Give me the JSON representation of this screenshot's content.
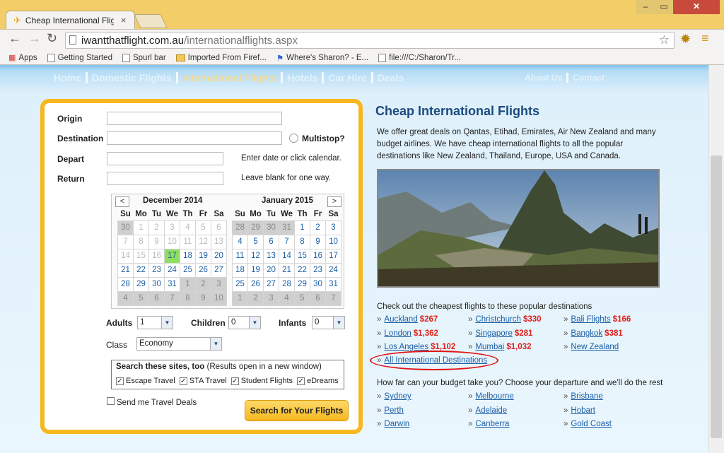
{
  "browser": {
    "tab_title": "Cheap International Flight",
    "tab_close": "×",
    "url_host": "iwantthatflight.com.au",
    "url_path": "/internationalflights.aspx",
    "bookmarks": [
      "Apps",
      "Getting Started",
      "Spurl bar",
      "Imported From Firef...",
      "Where's Sharon? - E...",
      "file:///C:/Sharon/Tr..."
    ]
  },
  "site_nav": {
    "left": [
      "Home",
      "Domestic Flights",
      "International Flights",
      "Hotels",
      "Car Hire",
      "Deals"
    ],
    "right": [
      "About Us",
      "Contact"
    ]
  },
  "form": {
    "origin_label": "Origin",
    "destination_label": "Destination",
    "multistop_label": "Multistop?",
    "depart_label": "Depart",
    "depart_hint": "Enter date or click calendar.",
    "return_label": "Return",
    "return_hint": "Leave blank for one way.",
    "adults_label": "Adults",
    "adults_value": "1",
    "children_label": "Children",
    "children_value": "0",
    "infants_label": "Infants",
    "infants_value": "0",
    "class_label": "Class",
    "class_value": "Economy",
    "sites_title": "Search these sites, too",
    "sites_note": "(Results open in a new window)",
    "sites": [
      "Escape Travel",
      "STA Travel",
      "Student Flights",
      "eDreams"
    ],
    "deals_label": "Send me Travel Deals",
    "search_button": "Search for Your Flights"
  },
  "calendar": {
    "prev": "<",
    "next": ">",
    "weekdays": [
      "Su",
      "Mo",
      "Tu",
      "We",
      "Th",
      "Fr",
      "Sa"
    ],
    "months": [
      {
        "title": "December 2014",
        "rows": [
          [
            "30",
            "1",
            "2",
            "3",
            "4",
            "5",
            "6"
          ],
          [
            "7",
            "8",
            "9",
            "10",
            "11",
            "12",
            "13"
          ],
          [
            "14",
            "15",
            "16",
            "17",
            "18",
            "19",
            "20"
          ],
          [
            "21",
            "22",
            "23",
            "24",
            "25",
            "26",
            "27"
          ],
          [
            "28",
            "29",
            "30",
            "31",
            "1",
            "2",
            "3"
          ],
          [
            "4",
            "5",
            "6",
            "7",
            "8",
            "9",
            "10"
          ]
        ]
      },
      {
        "title": "January 2015",
        "rows": [
          [
            "28",
            "29",
            "30",
            "31",
            "1",
            "2",
            "3"
          ],
          [
            "4",
            "5",
            "6",
            "7",
            "8",
            "9",
            "10"
          ],
          [
            "11",
            "12",
            "13",
            "14",
            "15",
            "16",
            "17"
          ],
          [
            "18",
            "19",
            "20",
            "21",
            "22",
            "23",
            "24"
          ],
          [
            "25",
            "26",
            "27",
            "28",
            "29",
            "30",
            "31"
          ],
          [
            "1",
            "2",
            "3",
            "4",
            "5",
            "6",
            "7"
          ]
        ]
      }
    ],
    "selected": "17"
  },
  "content": {
    "title": "Cheap International Flights",
    "intro": "We offer great deals on Qantas, Etihad, Emirates, Air New Zealand and many budget airlines. We have cheap international flights to all the popular destinations like New Zealand, Thailand, Europe, USA and Canada.",
    "popular_heading": "Check out the cheapest flights to these popular destinations",
    "popular": [
      {
        "city": "Auckland",
        "price": "$267"
      },
      {
        "city": "Christchurch",
        "price": "$330"
      },
      {
        "city": "Bali Flights",
        "price": "$166"
      },
      {
        "city": "London",
        "price": "$1,362"
      },
      {
        "city": "Singapore",
        "price": "$281"
      },
      {
        "city": "Bangkok",
        "price": "$381"
      },
      {
        "city": "Los Angeles",
        "price": "$1,102"
      },
      {
        "city": "Mumbai",
        "price": "$1,032"
      },
      {
        "city": "New Zealand",
        "price": ""
      }
    ],
    "all_link": "All International Destinations",
    "budget_heading": "How far can your budget take you? Choose your departure and we'll do the rest",
    "budget": [
      "Sydney",
      "Melbourne",
      "Brisbane",
      "Perth",
      "Adelaide",
      "Hobart",
      "Darwin",
      "Canberra",
      "Gold Coast"
    ],
    "bullet": "»"
  },
  "colors": {
    "accent": "#f6b71f",
    "heading": "#1a4a7e",
    "link": "#1d5fa5",
    "price": "#e0201b",
    "highlight_oval": "#e01414"
  }
}
